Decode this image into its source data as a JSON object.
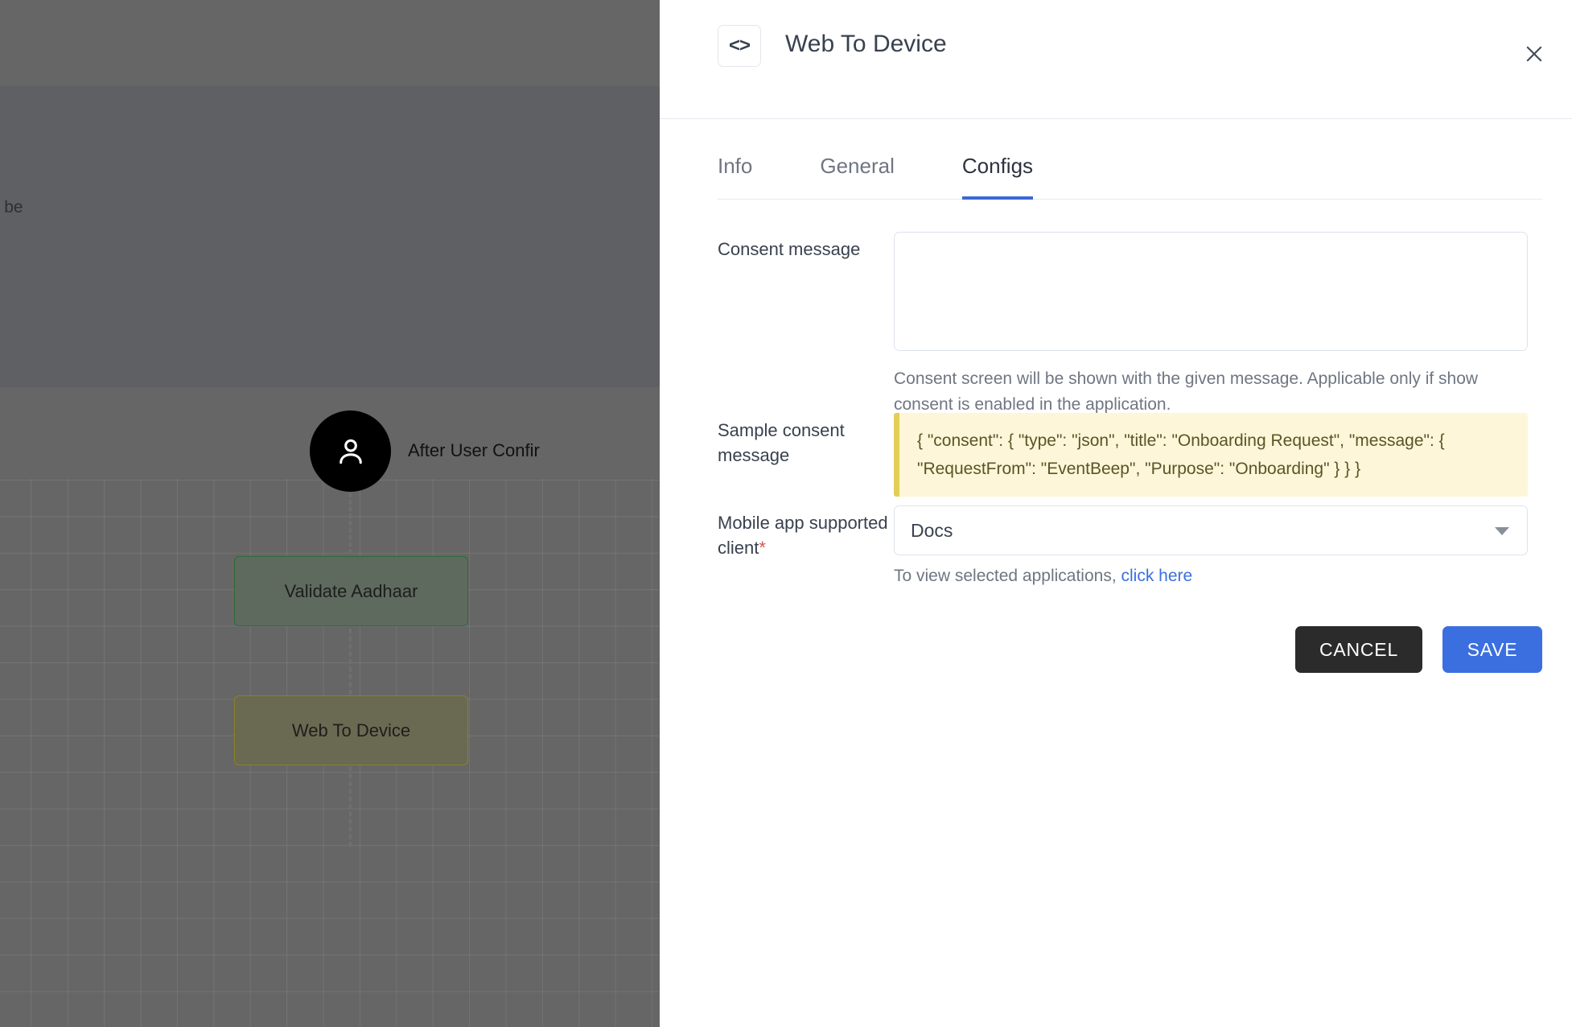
{
  "canvas": {
    "note_text": "an be",
    "edge_label": "After User Confir",
    "nodes": [
      {
        "id": "validate-aadhaar",
        "label": "Validate Aadhaar"
      },
      {
        "id": "web-to-device",
        "label": "Web To Device"
      }
    ],
    "user_node_icon": "user-icon"
  },
  "panel": {
    "header": {
      "icon": "code-brackets-icon",
      "icon_glyph": "<>",
      "title": "Web To Device",
      "close_icon": "close-icon"
    },
    "tabs": [
      {
        "label": "Info",
        "active": false
      },
      {
        "label": "General",
        "active": false
      },
      {
        "label": "Configs",
        "active": true
      }
    ],
    "form": {
      "consent": {
        "label": "Consent message",
        "value": "",
        "placeholder": "",
        "help": "Consent screen will be shown with the given message. Applicable only if show consent is enabled in the application."
      },
      "sample": {
        "label": "Sample consent message",
        "text": "{ \"consent\": { \"type\": \"json\", \"title\": \"Onboarding Request\", \"message\": { \"RequestFrom\": \"EventBeep\", \"Purpose\": \"Onboarding\" } } }"
      },
      "client": {
        "label": "Mobile app supported client",
        "required_marker": "*",
        "selected_value": "Docs",
        "dropdown_icon": "chevron-down-icon",
        "help_prefix": "To view selected applications, ",
        "help_link": "click here"
      }
    },
    "actions": {
      "cancel_label": "CANCEL",
      "save_label": "SAVE"
    }
  },
  "colors": {
    "accent_blue": "#3b6fe0",
    "tab_underline": "#3b68d8",
    "cancel_dark": "#2b2b2b",
    "sample_bg": "#fdf6d8",
    "sample_border": "#e3ce57",
    "required_red": "#d9534f",
    "canvas_gray": "#666666"
  }
}
